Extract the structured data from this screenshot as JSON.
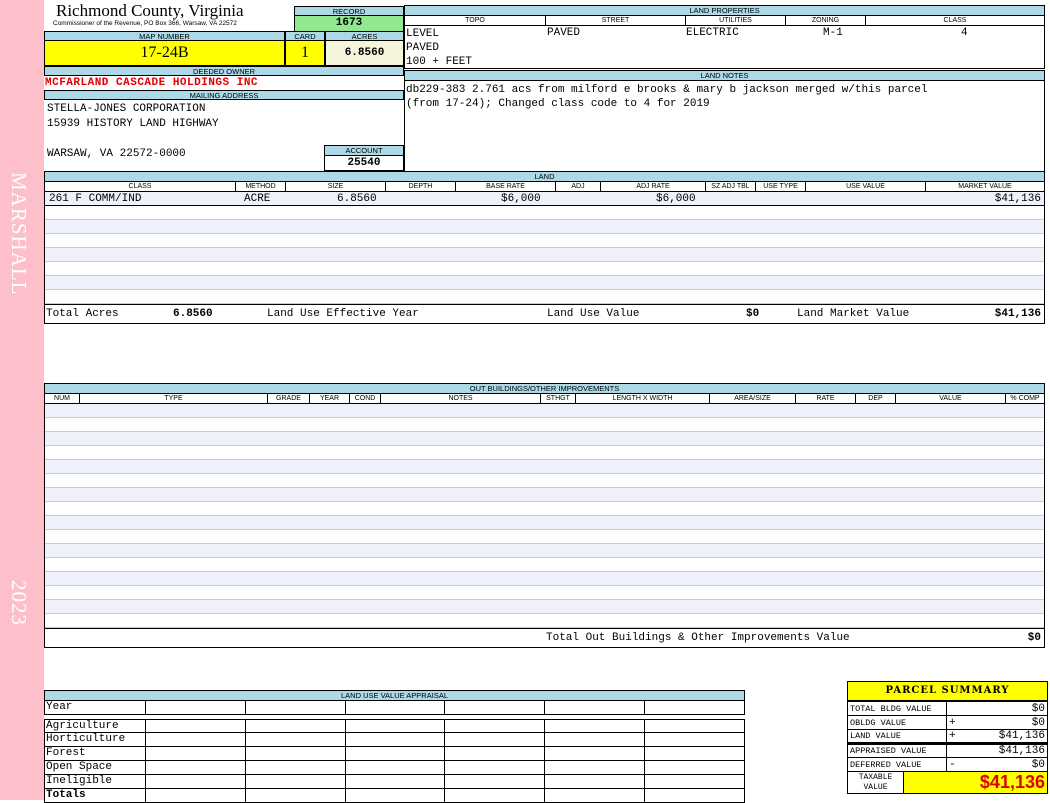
{
  "side": {
    "owner_tag": "MARSHALL",
    "year": "2023"
  },
  "header": {
    "title": "Richmond County, Virginia",
    "subtitle": "Commissioner of the Revenue, PO Box 366, Warsaw, VA 22572",
    "record_label": "RECORD",
    "record": "1673",
    "map_label": "MAP NUMBER",
    "map": "17-24B",
    "card_label": "CARD",
    "card": "1",
    "acres_label": "ACRES",
    "acres": "6.8560",
    "owner_label": "DEEDED OWNER",
    "owner": "MCFARLAND CASCADE HOLDINGS INC",
    "mailing_label": "MAILING ADDRESS",
    "address": [
      "STELLA-JONES CORPORATION",
      "15939 HISTORY LAND HIGHWAY",
      "",
      "WARSAW, VA 22572-0000"
    ],
    "account_label": "ACCOUNT",
    "account": "25540"
  },
  "land_properties": {
    "title": "LAND PROPERTIES",
    "columns": [
      "TOPO",
      "STREET",
      "UTILITIES",
      "ZONING",
      "CLASS"
    ],
    "values": {
      "topo": [
        "LEVEL",
        "PAVED",
        "100 + FEET"
      ],
      "street": "PAVED",
      "utilities": "ELECTRIC",
      "zoning": "M-1",
      "class": "4"
    }
  },
  "land_notes": {
    "title": "LAND NOTES",
    "lines": [
      "db229-383 2.761 acs from milford e brooks & mary b jackson merged w/this parcel",
      "(from 17-24); Changed class code to 4 for 2019"
    ]
  },
  "land": {
    "title": "LAND",
    "columns": [
      "CLASS",
      "METHOD",
      "SIZE",
      "DEPTH",
      "BASE RATE",
      "ADJ",
      "ADJ RATE",
      "SZ ADJ TBL",
      "USE TYPE",
      "USE VALUE",
      "MARKET VALUE"
    ],
    "rows": [
      {
        "class": "261 F COMM/IND",
        "method": "ACRE",
        "size": "6.8560",
        "base_rate": "$6,000",
        "adj_rate": "$6,000",
        "market_value": "$41,136"
      }
    ],
    "totals": {
      "total_acres_label": "Total Acres",
      "total_acres": "6.8560",
      "effective_year_label": "Land Use Effective Year",
      "use_value_label": "Land Use Value",
      "use_value": "$0",
      "market_value_label": "Land Market Value",
      "market_value": "$41,136"
    }
  },
  "outbuildings": {
    "title": "OUT BUILDINGS/OTHER IMPROVEMENTS",
    "columns": [
      "NUM",
      "TYPE",
      "GRADE",
      "YEAR",
      "COND",
      "NOTES",
      "STHGT",
      "LENGTH X WIDTH",
      "AREA/SIZE",
      "RATE",
      "DEP",
      "VALUE",
      "% COMP"
    ],
    "total_label": "Total Out Buildings & Other Improvements Value",
    "total": "$0"
  },
  "land_use_appraisal": {
    "title": "LAND USE VALUE APPRAISAL",
    "year_label": "Year",
    "rows": [
      "Agriculture",
      "Horticulture",
      "Forest",
      "Open Space",
      "Ineligible"
    ],
    "totals_label": "Totals"
  },
  "parcel_summary": {
    "title": "PARCEL SUMMARY",
    "rows": [
      {
        "label": "TOTAL BLDG VALUE",
        "op": "",
        "value": "$0"
      },
      {
        "label": "OBLDG VALUE",
        "op": "+",
        "value": "$0"
      },
      {
        "label": "LAND VALUE",
        "op": "+",
        "value": "$41,136"
      },
      {
        "label": "APPRAISED VALUE",
        "op": "",
        "value": "$41,136"
      },
      {
        "label": "DEFERRED VALUE",
        "op": "-",
        "value": "$0"
      }
    ],
    "taxable_label": "TAXABLE VALUE",
    "taxable": "$41,136"
  },
  "colors": {
    "header_blue": "#add8e6",
    "record_green": "#90e890",
    "highlight_yellow": "#ffff00",
    "owner_red": "#e00000",
    "strip_pink": "#fdc0cb"
  }
}
